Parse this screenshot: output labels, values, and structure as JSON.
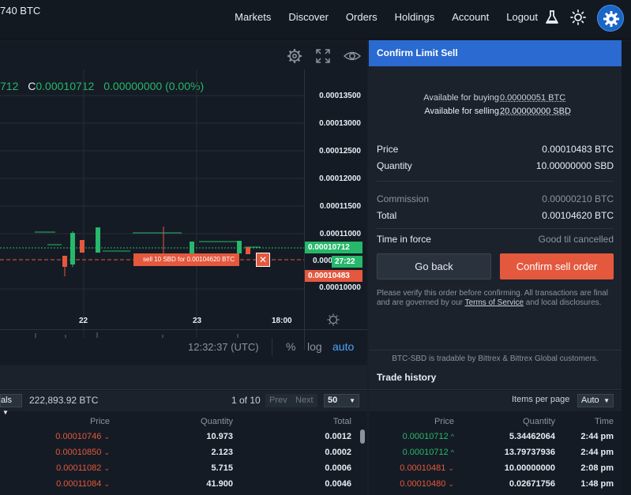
{
  "topbar": {
    "price": "740 BTC",
    "nav": [
      "Markets",
      "Discover",
      "Orders",
      "Holdings",
      "Account",
      "Logout"
    ],
    "icons": [
      "flask-icon",
      "sun-icon",
      "gear-icon"
    ]
  },
  "chart": {
    "ohlc_fragment": "712",
    "close_label": "C",
    "close_value": "0.00010712",
    "change": "0.00000000 (0.00%)",
    "y_ticks": [
      "0.00013500",
      "0.00013000",
      "0.00012500",
      "0.00012000",
      "0.00011500",
      "0.00011000",
      "0.00010000"
    ],
    "y_tick_partial": "0.000",
    "x_ticks": [
      "22",
      "23",
      "18:00"
    ],
    "last_price_tag": "0.00010712",
    "countdown_tag": "27:22",
    "order_price_tag": "0.00010483",
    "order_chip": "sell 10 SBD for 0.00104620 BTC",
    "order_chip_close": "✕",
    "time": "12:32:37 (UTC)",
    "pct": "%",
    "log": "log",
    "auto": "auto",
    "colors": {
      "up": "#26b86b",
      "down": "#e4583e"
    }
  },
  "confirm": {
    "title": "Confirm Limit Sell",
    "available_buying_label": "Available for buying",
    "available_buying_value": "0.00000051 BTC",
    "available_selling_label": "Available for selling",
    "available_selling_value": "20.00000000 SBD",
    "price_label": "Price",
    "price_value": "0.00010483 BTC",
    "quantity_label": "Quantity",
    "quantity_value": "10.00000000 SBD",
    "commission_label": "Commission",
    "commission_value": "0.00000210 BTC",
    "total_label": "Total",
    "total_value": "0.00104620 BTC",
    "tif_label": "Time in force",
    "tif_value": "Good til cancelled",
    "go_back": "Go back",
    "confirm_sell": "Confirm sell order",
    "verify_note_pre": "Please verify this order before confirming. All transactions are final and are governed by our ",
    "terms_link": "Terms of Service",
    "verify_note_post": " and local disclosures.",
    "tradable_note": "BTC-SBD is tradable by Bittrex & Bittrex Global customers."
  },
  "orderbook": {
    "units_select": "als",
    "total_value": "222,893.92 BTC",
    "page_info": "1 of 10",
    "prev": "Prev",
    "next": "Next",
    "page_size": "50",
    "headers": {
      "price": "Price",
      "quantity": "Quantity",
      "total": "Total"
    },
    "rows": [
      {
        "price": "0.00010746",
        "quantity": "10.973",
        "total": "0.0012"
      },
      {
        "price": "0.00010850",
        "quantity": "2.123",
        "total": "0.0002"
      },
      {
        "price": "0.00011082",
        "quantity": "5.715",
        "total": "0.0006"
      },
      {
        "price": "0.00011084",
        "quantity": "41.900",
        "total": "0.0046"
      }
    ]
  },
  "trades": {
    "title": "Trade history",
    "items_per_page_label": "Items per page",
    "items_per_page_value": "Auto",
    "headers": {
      "price": "Price",
      "quantity": "Quantity",
      "time": "Time"
    },
    "rows": [
      {
        "price": "0.00010712",
        "dir": "up",
        "quantity": "5.34462064",
        "time": "2:44 pm"
      },
      {
        "price": "0.00010712",
        "dir": "up",
        "quantity": "13.79737936",
        "time": "2:44 pm"
      },
      {
        "price": "0.00010481",
        "dir": "down",
        "quantity": "10.00000000",
        "time": "2:08 pm"
      },
      {
        "price": "0.00010480",
        "dir": "down",
        "quantity": "0.02671756",
        "time": "1:48 pm"
      }
    ]
  }
}
